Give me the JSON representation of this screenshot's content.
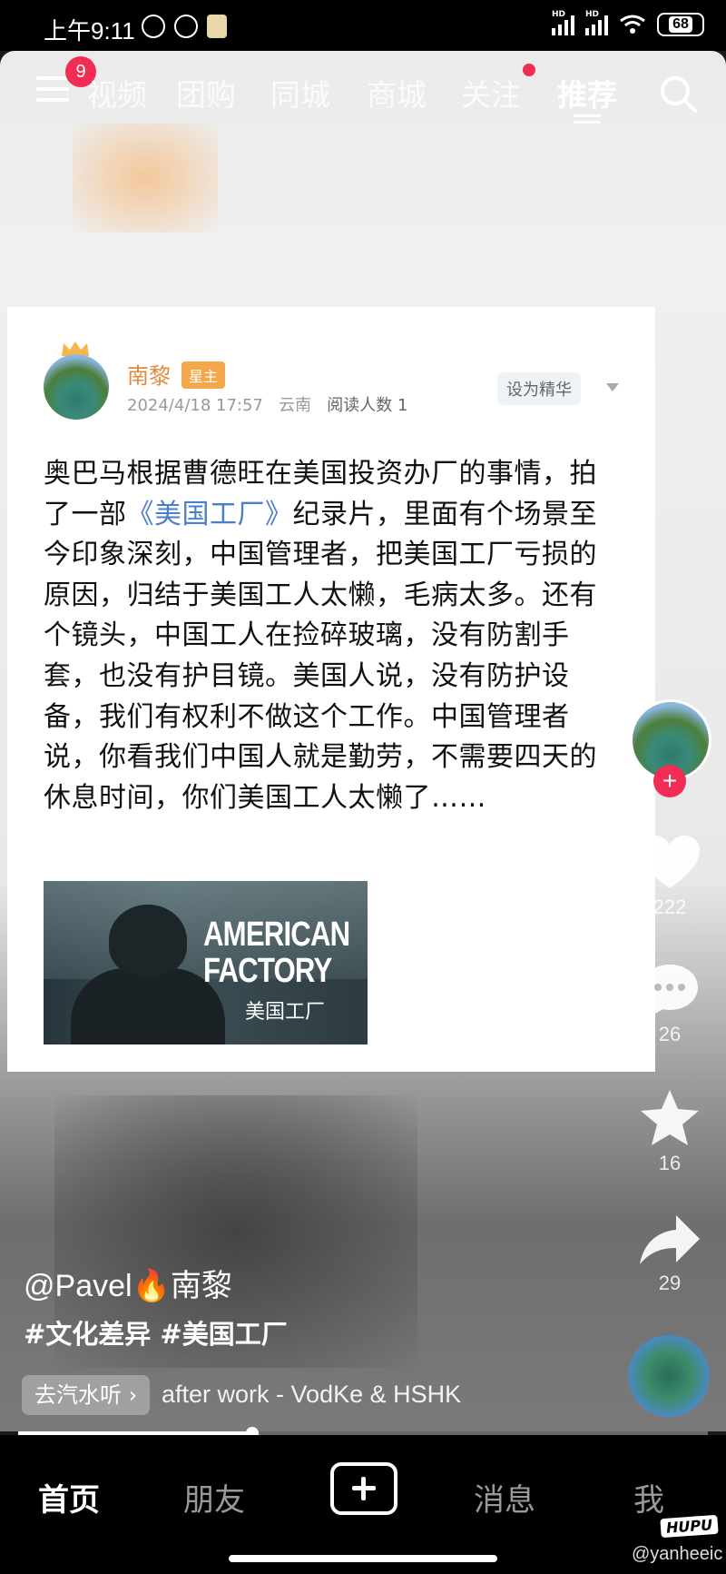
{
  "status_bar": {
    "time": "上午9:11",
    "battery": "68",
    "network_label": "HD"
  },
  "top_nav": {
    "menu_badge": "9",
    "tabs": [
      {
        "label": "视频"
      },
      {
        "label": "团购"
      },
      {
        "label": "同城"
      },
      {
        "label": "商城"
      },
      {
        "label": "关注"
      },
      {
        "label": "推荐",
        "active": true
      }
    ]
  },
  "post": {
    "author": "南黎",
    "author_badge": "星主",
    "date": "2024/4/18 17:57",
    "location": "云南",
    "reads": "阅读人数 1",
    "essence_button": "设为精华",
    "text_before_link": "奥巴马根据曹德旺在美国投资办厂的事情，拍了一部",
    "link_text": "《美国工厂》",
    "text_after_link": "纪录片，里面有个场景至今印象深刻，中国管理者，把美国工厂亏损的原因，归结于美国工人太懒，毛病太多。还有个镜头，中国工人在捡碎玻璃，没有防割手套，也没有护目镜。美国人说，没有防护设备，我们有权利不做这个工作。中国管理者说，你看我们中国人就是勤劳，不需要四天的休息时间，你们美国工人太懒了……",
    "movie_title_line1": "AMERICAN",
    "movie_title_line2": "FACTORY",
    "movie_title_cn": "美国工厂"
  },
  "rail": {
    "likes": "222",
    "comments": "26",
    "favorites": "16",
    "shares": "29",
    "follow_symbol": "+"
  },
  "overlay": {
    "user_line_prefix": "@Pavel",
    "user_line_emoji": "🔥",
    "user_line_name": "南黎",
    "tags": "#文化差异 #美国工厂",
    "music_chip": "去汽水听 ›",
    "music_title": "after work - VodKe & HSHK",
    "progress": 0.34
  },
  "tabbar": {
    "tabs": [
      {
        "label": "首页",
        "active": true
      },
      {
        "label": "朋友"
      },
      {
        "label": "消息"
      },
      {
        "label": "我"
      }
    ],
    "hupu_logo": "HUPU",
    "watermark": "@yanheeic"
  },
  "icons": {
    "search": "search-icon",
    "menu": "menu-icon",
    "like": "heart-icon",
    "comment": "comment-icon",
    "favorite": "star-icon",
    "share": "share-icon",
    "alarm": "alarm-icon",
    "clock": "clock-icon",
    "calendar": "calendar-icon",
    "wifi": "wifi-icon"
  },
  "colors": {
    "accent_red": "#f12c55",
    "author_orange": "#e08a3e",
    "badge_orange": "#f3a64a",
    "link_blue": "#4a7fc9"
  }
}
